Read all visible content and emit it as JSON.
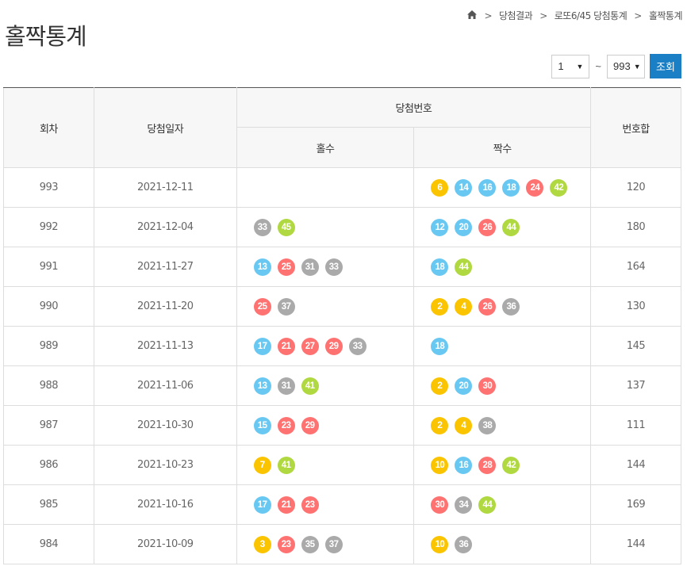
{
  "page": {
    "title": "홀짝통계",
    "breadcrumb": [
      "당첨결과",
      "로또6/45 당첨통계",
      "홀짝통계"
    ]
  },
  "controls": {
    "start_round": "1",
    "end_round": "993",
    "tilde": "~",
    "search_label": "조회"
  },
  "table": {
    "headers": {
      "round": "회차",
      "date": "당첨일자",
      "numbers": "당첨번호",
      "odd": "홀수",
      "even": "짝수",
      "sum": "번호합"
    },
    "rows": [
      {
        "round": "993",
        "date": "2021-12-11",
        "odd": [],
        "even": [
          6,
          14,
          16,
          18,
          24,
          42
        ],
        "sum": "120"
      },
      {
        "round": "992",
        "date": "2021-12-04",
        "odd": [
          33,
          45
        ],
        "even": [
          12,
          20,
          26,
          44
        ],
        "sum": "180"
      },
      {
        "round": "991",
        "date": "2021-11-27",
        "odd": [
          13,
          25,
          31,
          33
        ],
        "even": [
          18,
          44
        ],
        "sum": "164"
      },
      {
        "round": "990",
        "date": "2021-11-20",
        "odd": [
          25,
          37
        ],
        "even": [
          2,
          4,
          26,
          36
        ],
        "sum": "130"
      },
      {
        "round": "989",
        "date": "2021-11-13",
        "odd": [
          17,
          21,
          27,
          29,
          33
        ],
        "even": [
          18
        ],
        "sum": "145"
      },
      {
        "round": "988",
        "date": "2021-11-06",
        "odd": [
          13,
          31,
          41
        ],
        "even": [
          2,
          20,
          30
        ],
        "sum": "137"
      },
      {
        "round": "987",
        "date": "2021-10-30",
        "odd": [
          15,
          23,
          29
        ],
        "even": [
          2,
          4,
          38
        ],
        "sum": "111"
      },
      {
        "round": "986",
        "date": "2021-10-23",
        "odd": [
          7,
          41
        ],
        "even": [
          10,
          16,
          28,
          42
        ],
        "sum": "144"
      },
      {
        "round": "985",
        "date": "2021-10-16",
        "odd": [
          17,
          21,
          23
        ],
        "even": [
          30,
          34,
          44
        ],
        "sum": "169"
      },
      {
        "round": "984",
        "date": "2021-10-09",
        "odd": [
          3,
          23,
          35,
          37
        ],
        "even": [
          10,
          36
        ],
        "sum": "144"
      }
    ]
  },
  "ball_colors": {
    "1-10": "#fbc400",
    "11-20": "#69c8f2",
    "21-30": "#ff7272",
    "31-40": "#aaaaaa",
    "41-45": "#b0d840"
  }
}
